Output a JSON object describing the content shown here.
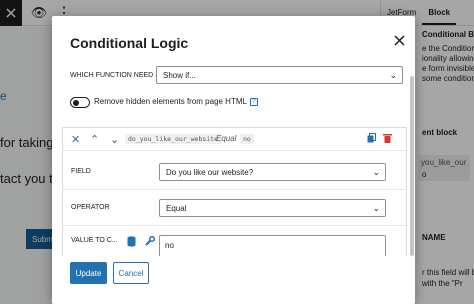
{
  "background": {
    "toolbar_eye": "👁",
    "toolbar_dots": "⋮",
    "text_lines": [
      "e",
      "for taking th",
      "tact you t"
    ],
    "submit_label": "Subm",
    "sidebar": {
      "tabs": [
        "JetForm",
        "Block"
      ],
      "fragments": [
        "Conditional Block",
        "e the Conditional",
        "ionality allowin",
        "e form invisible",
        "some condition",
        "ent block",
        "o"
      ],
      "box_text": "you_like_our",
      "bottom_fragments": [
        "NAME",
        "r this field will be",
        "with the \"Pr"
      ]
    }
  },
  "modal": {
    "title": "Conditional Logic",
    "which_function_label": "WHICH FUNCTION NEED ...",
    "which_function_value": "Show if...",
    "remove_hidden_label": "Remove hidden elements from page HTML",
    "help_glyph": "?",
    "condition": {
      "field_chip": "do_you_like_our_website",
      "operator_text": "Equal",
      "value_chip": "no",
      "field_label": "FIELD",
      "field_value": "Do you like our website?",
      "operator_label": "OPERATOR",
      "operator_value": "Equal",
      "value_label": "VALUE TO C...",
      "value_text": "no"
    },
    "update_label": "Update",
    "cancel_label": "Cancel"
  }
}
